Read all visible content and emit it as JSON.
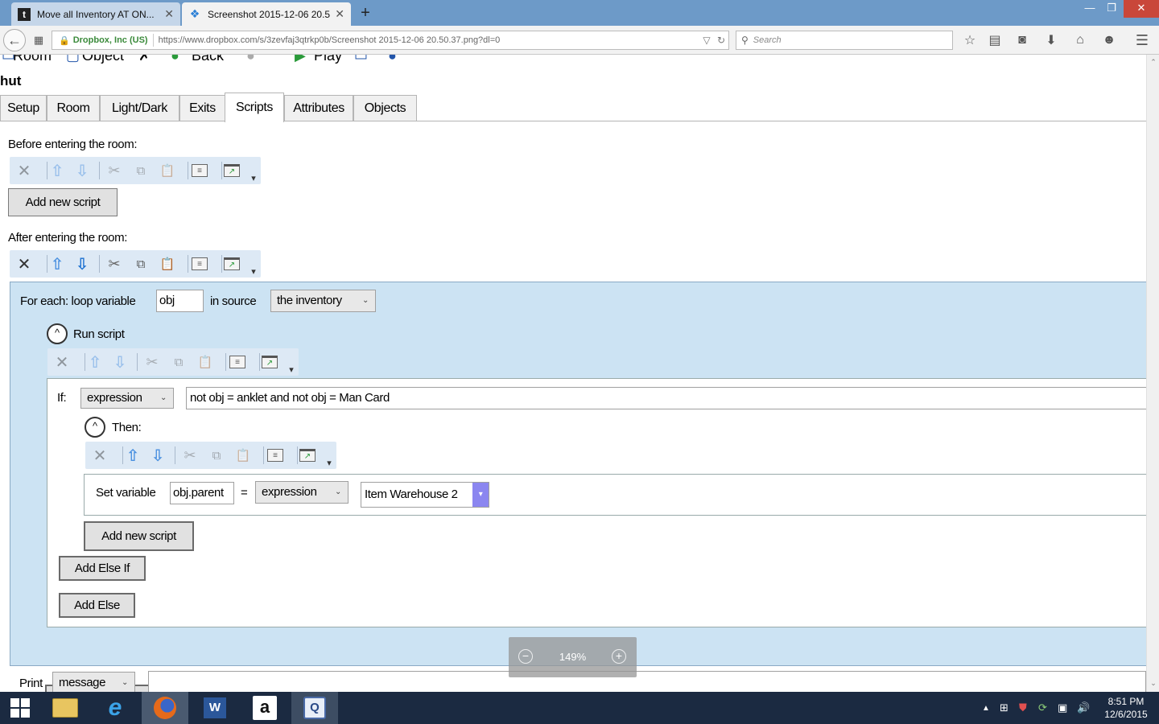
{
  "browser": {
    "tabs": [
      {
        "label": "Move all Inventory AT ON...",
        "favicon": "t"
      },
      {
        "label": "Screenshot 2015-12-06 20.5...",
        "favicon": "dropbox-icon"
      }
    ],
    "url_org": "Dropbox, Inc (US)",
    "url": "https://www.dropbox.com/s/3zevfaj3qtrkp0b/Screenshot 2015-12-06 20.50.37.png?dl=0",
    "search_placeholder": "Search"
  },
  "app": {
    "top_toolbar": {
      "room": "Room",
      "object": "Object",
      "back": "Back",
      "play": "Play"
    },
    "room_title": "hut",
    "tabs": [
      "Setup",
      "Room",
      "Light/Dark",
      "Exits",
      "Scripts",
      "Attributes",
      "Objects"
    ],
    "selected_tab": "Scripts",
    "before_label": "Before entering the room:",
    "after_label": "After entering the room:",
    "add_new_script": "Add new script",
    "foreach": {
      "label": "For each: loop variable",
      "variable": "obj",
      "in_source": "in source",
      "source": "the inventory"
    },
    "run_script": "Run script",
    "if_block": {
      "label": "If:",
      "mode": "expression",
      "expression": "not obj = anklet and not obj = Man Card",
      "then_label": "Then:"
    },
    "set_variable": {
      "label": "Set variable",
      "variable": "obj.parent",
      "equals": "=",
      "mode": "expression",
      "value": "Item Warehouse 2"
    },
    "add_else_if": "Add Else If",
    "add_else": "Add Else",
    "print": {
      "label": "Print",
      "mode": "message"
    }
  },
  "zoom": {
    "value": "149%"
  },
  "taskbar": {
    "time": "8:51 PM",
    "date": "12/6/2015"
  }
}
